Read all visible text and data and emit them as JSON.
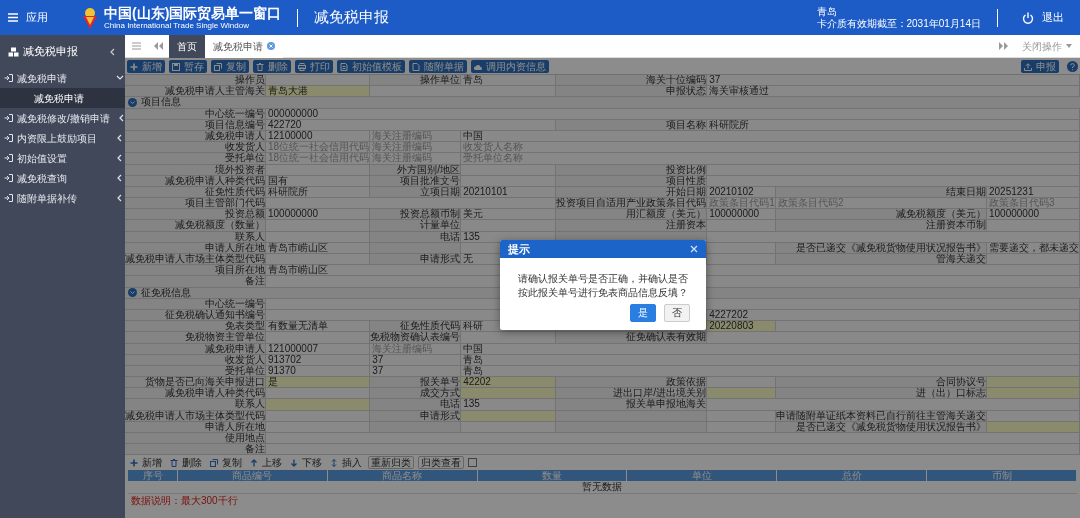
{
  "header": {
    "menu_label": "应用",
    "site_title": "中国(山东)国际贸易单一窗口",
    "site_subtitle": "China International Trade Single Window",
    "module_title": "减免税申报",
    "user": "青岛",
    "card_expiry": "卡介质有效期截至：2031年01月14日",
    "logout": "退出"
  },
  "sidebar": {
    "title": "减免税申报",
    "items": [
      {
        "label": "减免税申请",
        "expanded": true,
        "children": [
          {
            "label": "减免税申请",
            "selected": true
          }
        ]
      },
      {
        "label": "减免税修改/撤销申请",
        "expanded": false
      },
      {
        "label": "内资限上鼓励项目",
        "expanded": false
      },
      {
        "label": "初始值设置",
        "expanded": false
      },
      {
        "label": "减免税查询",
        "expanded": false
      },
      {
        "label": "随附单据补传",
        "expanded": false
      }
    ]
  },
  "tabs": [
    {
      "kind": "home",
      "label": "首页",
      "selected": false
    },
    {
      "kind": "page",
      "label": "减免税申请",
      "selected": true
    }
  ],
  "tab_actions": "关闭操作",
  "toolbar": [
    {
      "kind": "add",
      "label": "新增"
    },
    {
      "kind": "save",
      "label": "暂存"
    },
    {
      "kind": "copy",
      "label": "复制"
    },
    {
      "kind": "delete",
      "label": "删除"
    },
    {
      "kind": "print",
      "label": "打印"
    },
    {
      "kind": "template",
      "label": "初始值模板"
    },
    {
      "kind": "attachment",
      "label": "随附单据"
    },
    {
      "kind": "import",
      "label": "调用内资信息"
    }
  ],
  "submit_button": {
    "kind": "upload",
    "label": "申报"
  },
  "form": [
    {
      "kind": "fields",
      "fields": [
        {
          "label": "操作员",
          "inputs": [
            {
              "required": false
            }
          ]
        },
        {
          "label": "操作单位",
          "inputs": [
            {
              "value": "青岛",
              "required": false
            }
          ]
        },
        {
          "label": "海关十位编码",
          "inputs": [
            {
              "value": "37",
              "required": false
            }
          ]
        }
      ]
    },
    {
      "kind": "fields",
      "fields": [
        {
          "label": "减免税申请人主管海关",
          "inputs": [
            {
              "value": "青岛大港",
              "required": true
            },
            {
              "required": false
            }
          ]
        },
        {
          "label": "申报状态",
          "inputs": [
            {
              "value": "海关审核通过",
              "required": false
            }
          ]
        }
      ]
    },
    {
      "kind": "section",
      "title": "项目信息"
    },
    {
      "kind": "fields",
      "fields": [
        {
          "label": "中心统一编号",
          "inputs": [
            {
              "value": "000000000",
              "required": false
            }
          ]
        }
      ]
    },
    {
      "kind": "fields",
      "fields": [
        {
          "label": "项目信息编号",
          "inputs": [
            {
              "value": "422720",
              "required": false
            }
          ]
        },
        {
          "label": "项目名称",
          "inputs": [
            {
              "value": "科研院所",
              "required": false
            }
          ]
        }
      ]
    },
    {
      "kind": "fields",
      "fields": [
        {
          "label": "减免税申请人",
          "inputs": [
            {
              "value": "12100000",
              "required": false
            },
            {
              "placeholder": "海关注册编码",
              "required": false
            },
            {
              "value": "中国",
              "required": false
            }
          ]
        }
      ]
    },
    {
      "kind": "fields",
      "fields": [
        {
          "label": "收发货人",
          "inputs": [
            {
              "placeholder": "18位统一社会信用代码",
              "required": false
            },
            {
              "placeholder": "海关注册编码",
              "required": false
            },
            {
              "placeholder": "收发货人名称",
              "required": false
            }
          ]
        }
      ]
    },
    {
      "kind": "fields",
      "fields": [
        {
          "label": "受托单位",
          "inputs": [
            {
              "placeholder": "18位统一社会信用代码",
              "required": false
            },
            {
              "placeholder": "海关注册编码",
              "required": false
            },
            {
              "placeholder": "受托单位名称",
              "required": false
            }
          ]
        }
      ]
    },
    {
      "kind": "fields",
      "fields": [
        {
          "label": "境外投资者",
          "inputs": [
            {
              "required": false
            }
          ]
        },
        {
          "label": "外方国别/地区",
          "inputs": [
            {
              "required": false
            }
          ]
        },
        {
          "label": "投资比例",
          "inputs": [
            {
              "required": false
            }
          ]
        }
      ]
    },
    {
      "kind": "fields",
      "fields": [
        {
          "label": "减免税申请人种类代码",
          "inputs": [
            {
              "value": "国有",
              "required": false
            }
          ]
        },
        {
          "label": "项目批准文号",
          "inputs": [
            {
              "required": false
            }
          ]
        },
        {
          "label": "项目性质",
          "inputs": [
            {
              "required": false
            }
          ]
        }
      ]
    },
    {
      "kind": "fields",
      "fields": [
        {
          "label": "征免性质代码",
          "inputs": [
            {
              "value": "科研院所",
              "required": false
            }
          ]
        },
        {
          "label": "立项日期",
          "inputs": [
            {
              "value": "20210101",
              "required": false
            }
          ]
        },
        {
          "label": "开始日期",
          "inputs": [
            {
              "value": "20210102",
              "required": false
            }
          ]
        },
        {
          "label": "结束日期",
          "inputs": [
            {
              "value": "20251231",
              "required": false
            }
          ]
        }
      ]
    },
    {
      "kind": "fields",
      "fields": [
        {
          "label": "项目主管部门代码",
          "inputs": [
            {
              "required": false
            }
          ]
        },
        {
          "label": "投资项目自适用产业政策条目代码",
          "inputs": [
            {
              "placeholder": "政策条目代码1",
              "required": false
            },
            {
              "placeholder": "政策条目代码2",
              "required": false
            },
            {
              "placeholder": "政策条目代码3",
              "required": false
            }
          ]
        }
      ]
    },
    {
      "kind": "fields",
      "fields": [
        {
          "label": "投资总额",
          "inputs": [
            {
              "value": "100000000",
              "required": false
            }
          ]
        },
        {
          "label": "投资总额币制",
          "inputs": [
            {
              "value": "美元",
              "required": false
            }
          ]
        },
        {
          "label": "用汇额度（美元）",
          "inputs": [
            {
              "value": "100000000",
              "required": false
            }
          ]
        },
        {
          "label": "减免税额度（美元）",
          "inputs": [
            {
              "value": "100000000",
              "required": false
            }
          ]
        }
      ]
    },
    {
      "kind": "fields",
      "fields": [
        {
          "label": "减免税额度（数量）",
          "inputs": [
            {
              "required": false
            }
          ]
        },
        {
          "label": "计量单位",
          "inputs": [
            {
              "required": false
            }
          ]
        },
        {
          "label": "注册资本",
          "inputs": [
            {
              "required": false
            }
          ]
        },
        {
          "label": "注册资本币制",
          "inputs": [
            {
              "required": false
            }
          ]
        }
      ]
    },
    {
      "kind": "fields",
      "fields": [
        {
          "label": "联系人",
          "inputs": [
            {
              "required": false
            }
          ]
        },
        {
          "label": "电话",
          "inputs": [
            {
              "value": "135",
              "required": false
            }
          ]
        },
        {
          "inputs": [
            {
              "required": false
            }
          ]
        }
      ]
    },
    {
      "kind": "fields",
      "fields": [
        {
          "label": "申请人所在地",
          "inputs": [
            {
              "value": "青岛市崂山区",
              "required": false
            }
          ]
        },
        {
          "inputs": [
            {
              "required": false
            }
          ]
        },
        {
          "inputs": [
            {
              "required": false
            }
          ]
        },
        {
          "label": "是否已递交《减免税货物使用状况报告书》",
          "inputs": [
            {
              "value": "需要递交，都未递交",
              "required": false
            }
          ]
        }
      ]
    },
    {
      "kind": "fields",
      "fields": [
        {
          "label": "减免税申请人市场主体类型代码",
          "inputs": [
            {
              "required": false
            }
          ]
        },
        {
          "label": "申请形式",
          "inputs": [
            {
              "value": "无",
              "required": false
            }
          ]
        },
        {
          "inputs": [
            {
              "required": false
            }
          ]
        },
        {
          "label": "管海关递交",
          "inputs": [
            {
              "required": false
            }
          ]
        }
      ]
    },
    {
      "kind": "fields",
      "fields": [
        {
          "label": "项目所在地",
          "inputs": [
            {
              "value": "青岛市崂山区",
              "required": false
            }
          ]
        }
      ]
    },
    {
      "kind": "fields",
      "fields": [
        {
          "label": "备注",
          "inputs": [
            {
              "required": false
            }
          ]
        }
      ]
    },
    {
      "kind": "section",
      "title": "征免税信息"
    },
    {
      "kind": "fields",
      "fields": [
        {
          "label": "中心统一编号",
          "inputs": [
            {
              "required": false
            }
          ]
        }
      ]
    },
    {
      "kind": "fields",
      "fields": [
        {
          "label": "征免税确认通知书编号",
          "inputs": [
            {
              "required": false
            }
          ]
        },
        {
          "inputs": [
            {
              "value": "4227202",
              "required": false
            }
          ]
        }
      ]
    },
    {
      "kind": "fields",
      "fields": [
        {
          "label": "免表类型",
          "inputs": [
            {
              "value": "有数量无清单",
              "required": false
            }
          ]
        },
        {
          "label": "征免性质代码",
          "inputs": [
            {
              "value": "科研",
              "required": false
            }
          ]
        },
        {
          "inputs": [
            {
              "value": "20220803",
              "required": true
            },
            {
              "required": false
            }
          ]
        }
      ]
    },
    {
      "kind": "fields",
      "fields": [
        {
          "label": "免税物资主管单位",
          "inputs": [
            {
              "required": false
            }
          ]
        },
        {
          "label": "免税物资确认表编号",
          "inputs": [
            {
              "required": false
            }
          ]
        },
        {
          "label": "征免确认表有效期",
          "inputs": [
            {
              "required": false
            }
          ]
        }
      ]
    },
    {
      "kind": "fields",
      "fields": [
        {
          "label": "减免税申请人",
          "inputs": [
            {
              "value": "121000007",
              "required": false
            },
            {
              "placeholder": "海关注册编码",
              "required": false
            },
            {
              "value": "中国",
              "required": false
            }
          ]
        }
      ]
    },
    {
      "kind": "fields",
      "fields": [
        {
          "label": "收发货人",
          "inputs": [
            {
              "value": "913702",
              "required": false
            },
            {
              "value": "37",
              "required": false
            },
            {
              "value": "青岛",
              "required": false
            }
          ]
        }
      ]
    },
    {
      "kind": "fields",
      "fields": [
        {
          "label": "受托单位",
          "inputs": [
            {
              "value": "91370",
              "required": false
            },
            {
              "value": "37",
              "required": false
            },
            {
              "value": "青岛",
              "required": false
            }
          ]
        }
      ]
    },
    {
      "kind": "fields",
      "fields": [
        {
          "label": "货物是否已向海关申报进口",
          "inputs": [
            {
              "value": "是",
              "required": true
            }
          ]
        },
        {
          "label": "报关单号",
          "inputs": [
            {
              "value": "42202",
              "required": true
            }
          ]
        },
        {
          "label": "政策依据",
          "inputs": [
            {
              "required": false
            }
          ]
        },
        {
          "label": "合同协议号",
          "inputs": [
            {
              "required": true
            }
          ]
        }
      ]
    },
    {
      "kind": "fields",
      "fields": [
        {
          "label": "减免税申请人种类代码",
          "inputs": [
            {
              "required": false
            }
          ]
        },
        {
          "label": "成交方式",
          "inputs": [
            {
              "required": true
            }
          ]
        },
        {
          "label": "进出口岸/进出境关别",
          "inputs": [
            {
              "required": true
            }
          ]
        },
        {
          "label": "进（出）口标志",
          "inputs": [
            {
              "required": true
            }
          ]
        }
      ]
    },
    {
      "kind": "fields",
      "fields": [
        {
          "label": "联系人",
          "inputs": [
            {
              "required": true
            }
          ]
        },
        {
          "label": "电话",
          "inputs": [
            {
              "value": "135",
              "required": false
            }
          ]
        },
        {
          "label": "报关单申报地海关",
          "inputs": [
            {
              "required": false
            }
          ]
        }
      ]
    },
    {
      "kind": "fields",
      "fields": [
        {
          "label": "减免税申请人市场主体类型代码",
          "inputs": [
            {
              "required": false
            }
          ]
        },
        {
          "label": "申请形式",
          "inputs": [
            {
              "required": true
            }
          ]
        },
        {
          "inputs": [
            {
              "required": false
            }
          ]
        },
        {
          "label": "申请随附单证纸本资料已自行前往主管海关递交",
          "inputs": [
            {
              "required": false
            }
          ]
        }
      ]
    },
    {
      "kind": "fields",
      "fields": [
        {
          "label": "申请人所在地",
          "inputs": [
            {
              "required": false
            }
          ]
        },
        {
          "inputs": [
            {
              "required": false
            }
          ]
        },
        {
          "inputs": [
            {
              "required": false
            }
          ]
        },
        {
          "label": "是否已递交《减免税货物使用状况报告书》",
          "inputs": [
            {
              "required": true
            }
          ]
        }
      ]
    },
    {
      "kind": "fields",
      "fields": [
        {
          "label": "使用地点",
          "inputs": [
            {
              "required": false
            }
          ]
        }
      ]
    },
    {
      "kind": "fields",
      "fields": [
        {
          "label": "备注",
          "inputs": [
            {
              "required": false
            }
          ]
        }
      ]
    }
  ],
  "goods": {
    "toolbar": [
      {
        "kind": "add",
        "label": "新增"
      },
      {
        "kind": "delete",
        "label": "删除"
      },
      {
        "kind": "copy",
        "label": "复制"
      },
      {
        "kind": "up",
        "label": "上移"
      },
      {
        "kind": "down",
        "label": "下移"
      },
      {
        "kind": "insert",
        "label": "插入"
      },
      {
        "kind": "boxed",
        "label": "重新归类"
      },
      {
        "kind": "boxed",
        "label": "归类查看"
      }
    ],
    "toggle": {
      "checked": false
    },
    "columns": [
      "序号",
      "商品编号",
      "商品名称",
      "数量",
      "单位",
      "总价",
      "币制"
    ],
    "empty_text": "暂无数据"
  },
  "note": "数据说明：最大300千行",
  "dialog": {
    "title": "提示",
    "message": "请确认报关单号是否正确，并确认是否按此报关单号进行免表商品信息反填？",
    "buttons": [
      {
        "kind": "primary",
        "label": "是"
      },
      {
        "kind": "secondary",
        "label": "否"
      }
    ]
  }
}
